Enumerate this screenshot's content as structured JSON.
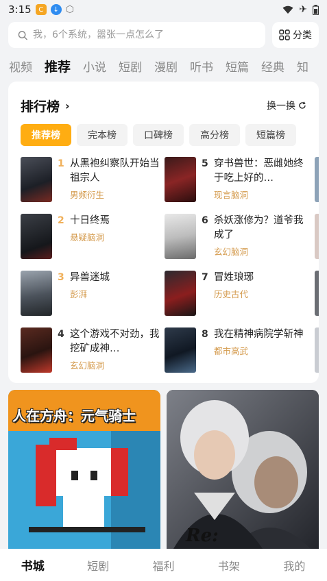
{
  "status_bar": {
    "time": "3:15",
    "icons": [
      "app-c-icon",
      "download-icon",
      "cube-icon",
      "wifi-icon",
      "airplane-icon",
      "battery-icon"
    ]
  },
  "search": {
    "placeholder": "我，6个系统，嚣张一点怎么了",
    "category_label": "分类"
  },
  "channels": [
    "视频",
    "推荐",
    "小说",
    "短剧",
    "漫剧",
    "听书",
    "短篇",
    "经典",
    "知"
  ],
  "active_channel": "推荐",
  "ranking": {
    "title": "排行榜",
    "refresh_label": "换一换",
    "tabs": [
      "推荐榜",
      "完本榜",
      "口碑榜",
      "高分榜",
      "短篇榜"
    ],
    "active_tab": "推荐榜",
    "books": [
      {
        "rank": "1",
        "title": "从黑袍纠察队开始当祖宗人",
        "genre": "男频衍生"
      },
      {
        "rank": "2",
        "title": "十日终焉",
        "genre": "悬疑脑洞"
      },
      {
        "rank": "3",
        "title": "异兽迷城",
        "genre": "彭湃"
      },
      {
        "rank": "4",
        "title": "这个游戏不对劲，我挖矿成神…",
        "genre": "玄幻脑洞"
      },
      {
        "rank": "5",
        "title": "穿书兽世：恶雌她终于吃上好的…",
        "genre": "现言脑洞"
      },
      {
        "rank": "6",
        "title": "杀妖涨修为？道爷我成了",
        "genre": "玄幻脑洞"
      },
      {
        "rank": "7",
        "title": "冒姓琅琊",
        "genre": "历史古代"
      },
      {
        "rank": "8",
        "title": "我在精神病院学斩神",
        "genre": "都市高武"
      }
    ]
  },
  "features": {
    "left_title": "人在方舟：元气骑士",
    "right_text": "Re:"
  },
  "bottom_nav": [
    "书城",
    "短剧",
    "福利",
    "书架",
    "我的"
  ],
  "active_nav": "书城",
  "colors": {
    "accent": "#ffad12",
    "genre": "#d49a4c",
    "background": "#f2f3f5"
  }
}
